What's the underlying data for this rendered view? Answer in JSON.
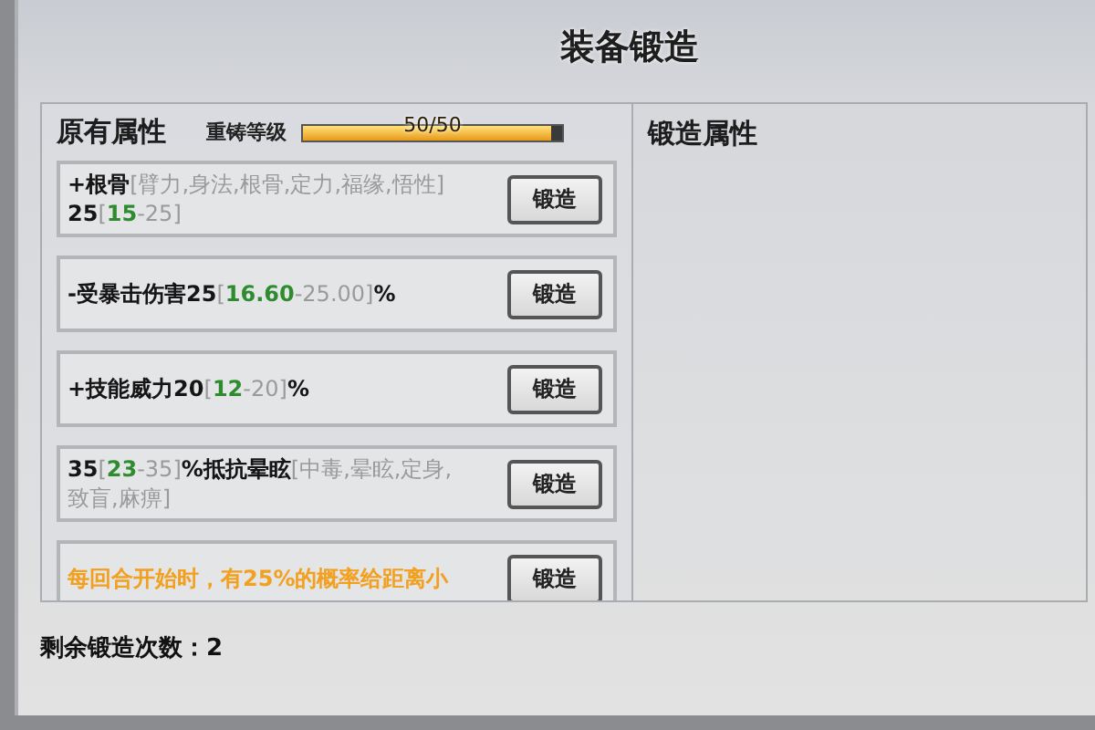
{
  "window": {
    "title": "装备锻造"
  },
  "original_panel": {
    "title": "原有属性",
    "recast": {
      "label": "重铸等级",
      "reading": "50/50",
      "level": 0.96
    },
    "attributes": [
      {
        "segments": [
          {
            "text": "+根骨",
            "kind": "main"
          },
          {
            "text": "[臂力,身法,根骨,定力,福缘,悟性]",
            "kind": "grey"
          },
          {
            "text": " 25",
            "kind": "main"
          },
          {
            "text": "[",
            "kind": "grey"
          },
          {
            "text": "15",
            "kind": "green"
          },
          {
            "text": "-25]",
            "kind": "grey"
          }
        ],
        "button": "锻造"
      },
      {
        "segments": [
          {
            "text": "-受暴击伤害25",
            "kind": "main"
          },
          {
            "text": "[",
            "kind": "grey"
          },
          {
            "text": "16.60",
            "kind": "green"
          },
          {
            "text": "-25.00]",
            "kind": "grey"
          },
          {
            "text": "%",
            "kind": "main"
          }
        ],
        "button": "锻造"
      },
      {
        "segments": [
          {
            "text": "+技能威力20",
            "kind": "main"
          },
          {
            "text": "[",
            "kind": "grey"
          },
          {
            "text": "12",
            "kind": "green"
          },
          {
            "text": "-20]",
            "kind": "grey"
          },
          {
            "text": "%",
            "kind": "main"
          }
        ],
        "button": "锻造"
      },
      {
        "segments": [
          {
            "text": "35",
            "kind": "main"
          },
          {
            "text": "[",
            "kind": "grey"
          },
          {
            "text": "23",
            "kind": "green"
          },
          {
            "text": "-35]",
            "kind": "grey"
          },
          {
            "text": "%抵抗晕眩",
            "kind": "main"
          },
          {
            "text": "[中毒,晕眩,定身,致盲,麻痹]",
            "kind": "grey"
          }
        ],
        "button": "锻造"
      },
      {
        "segments": [
          {
            "text": "每回合开始时，有25%的概率给距离小",
            "kind": "orange"
          }
        ],
        "button": "锻造"
      }
    ]
  },
  "forge_panel": {
    "title": "锻造属性"
  },
  "footer": {
    "remaining": "剩余锻造次数：2"
  }
}
